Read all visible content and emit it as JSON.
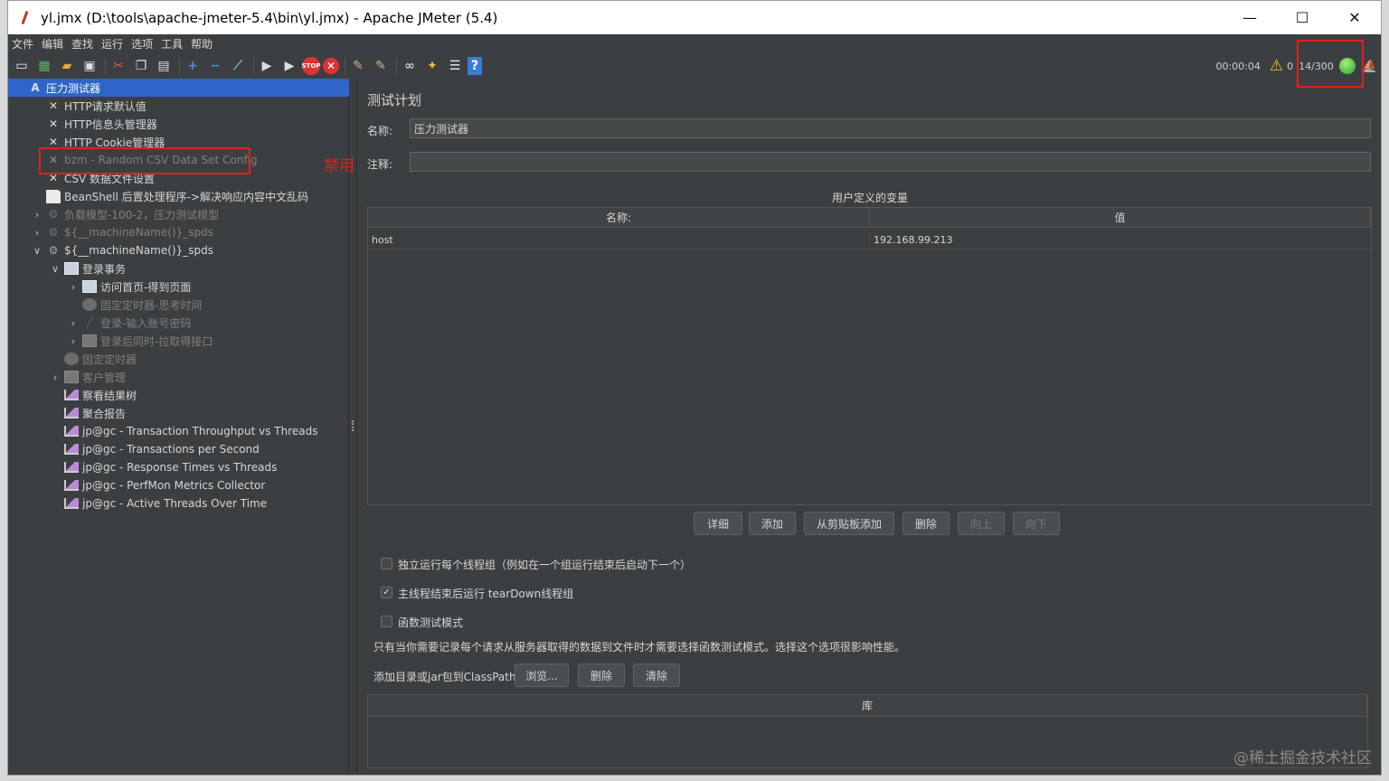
{
  "window": {
    "title": "yl.jmx (D:\\tools\\apache-jmeter-5.4\\bin\\yl.jmx) - Apache JMeter (5.4)",
    "minimize": "—",
    "maximize": "☐",
    "close": "✕"
  },
  "menu": [
    "文件",
    "编辑",
    "查找",
    "运行",
    "选项",
    "工具",
    "帮助"
  ],
  "toolbar": {
    "elapsed": "00:00:04",
    "errors": "0",
    "threads": "14/300"
  },
  "tree": [
    {
      "label": "压力测试器",
      "icon": "test-plan-icon",
      "state": "selected",
      "arrow": "⌄"
    },
    {
      "label": "HTTP请求默认值",
      "icon": "config-tool-icon",
      "state": "normal"
    },
    {
      "label": "HTTP信息头管理器",
      "icon": "config-tool-icon",
      "state": "normal"
    },
    {
      "label": "HTTP Cookie管理器",
      "icon": "config-tool-icon",
      "state": "normal"
    },
    {
      "label": "bzm - Random CSV Data Set Config",
      "icon": "config-tool-icon",
      "state": "disabled"
    },
    {
      "label": "CSV 数据文件设置",
      "icon": "config-tool-icon",
      "state": "normal"
    },
    {
      "label": "BeanShell 后置处理程序->解决响应内容中文乱码",
      "icon": "document-icon",
      "state": "normal"
    },
    {
      "label": "负载模型-100-2，压力测试模型",
      "icon": "gear-icon",
      "state": "disabled",
      "arrow": "›"
    },
    {
      "label": "${__machineName()}_spds",
      "icon": "gear-icon",
      "state": "disabled",
      "arrow": "›"
    },
    {
      "label": "${__machineName()}_spds",
      "icon": "gear-icon",
      "state": "normal",
      "arrow": "⌄"
    },
    {
      "label": "登录事务",
      "icon": "controller-icon",
      "state": "normal",
      "arrow": "⌄"
    },
    {
      "label": "访问首页-得到页面",
      "icon": "controller-icon",
      "state": "normal",
      "arrow": "›"
    },
    {
      "label": "固定定时器-思考时间",
      "icon": "timer-icon",
      "state": "disabled"
    },
    {
      "label": "登录-输入账号密码",
      "icon": "sampler-icon",
      "state": "disabled",
      "arrow": "›"
    },
    {
      "label": "登录后同时-拉取得接口",
      "icon": "controller-icon",
      "state": "disabled",
      "arrow": "›"
    },
    {
      "label": "固定定时器",
      "icon": "timer-icon",
      "state": "disabled"
    },
    {
      "label": "客户管理",
      "icon": "controller-icon",
      "state": "disabled",
      "arrow": "›"
    },
    {
      "label": "察看结果树",
      "icon": "chart-icon",
      "state": "normal"
    },
    {
      "label": "聚合报告",
      "icon": "chart-icon",
      "state": "normal"
    },
    {
      "label": "jp@gc - Transaction Throughput vs Threads",
      "icon": "chart-icon",
      "state": "normal"
    },
    {
      "label": "jp@gc - Transactions per Second",
      "icon": "chart-icon",
      "state": "normal"
    },
    {
      "label": "jp@gc - Response Times vs Threads",
      "icon": "chart-icon",
      "state": "normal"
    },
    {
      "label": "jp@gc - PerfMon Metrics Collector",
      "icon": "chart-icon",
      "state": "normal"
    },
    {
      "label": "jp@gc - Active Threads Over Time",
      "icon": "chart-icon",
      "state": "normal"
    }
  ],
  "annotation": "禁用",
  "panel": {
    "heading": "测试计划",
    "name_label": "名称:",
    "name_value": "压力测试器",
    "comment_label": "注释:",
    "comment_value": "",
    "vars_title": "用户定义的变量",
    "vars_columns": [
      "名称:",
      "值"
    ],
    "vars_rows": [
      [
        "host",
        "192.168.99.213"
      ]
    ],
    "buttons": {
      "detail": "详细",
      "add": "添加",
      "add_clipboard": "从剪贴板添加",
      "delete": "删除",
      "up": "向上",
      "down": "向下"
    },
    "cb_serial": "独立运行每个线程组（例如在一个组运行结束后启动下一个）",
    "cb_teardown": "主线程结束后运行 tearDown线程组",
    "cb_functional": "函数测试模式",
    "functional_note": "只有当你需要记录每个请求从服务器取得的数据到文件时才需要选择函数测试模式。选择这个选项很影响性能。",
    "classpath_label": "添加目录或jar包到ClassPath",
    "browse": "浏览...",
    "cp_delete": "删除",
    "cp_clear": "清除",
    "lib_header": "库"
  },
  "watermark": "@稀土掘金技术社区"
}
